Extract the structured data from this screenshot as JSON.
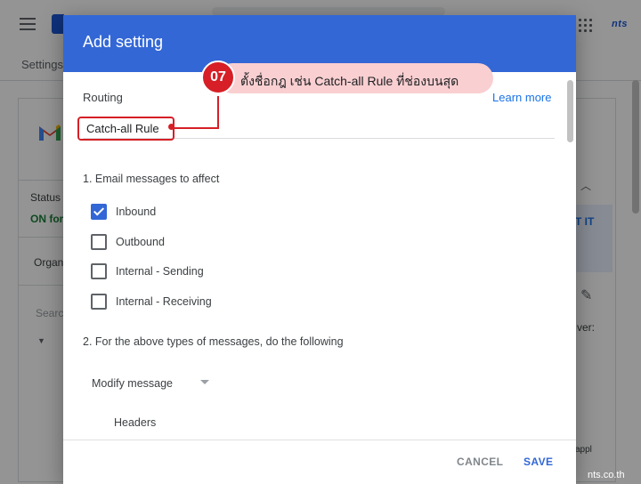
{
  "background": {
    "brand": "nts",
    "breadcrumb": "Settings",
    "status_label": "Status",
    "status_value": "ON for",
    "org_label": "Organ",
    "search_hint": "Searc",
    "right_blue_text": "T IT",
    "right_text": "ver:",
    "right_text2": "appl"
  },
  "dialog": {
    "title": "Add setting",
    "section_label": "Routing",
    "learn_more": "Learn more",
    "name_value": "Catch-all Rule",
    "step1_label": "1. Email messages to affect",
    "message_types": [
      {
        "label": "Inbound",
        "checked": true
      },
      {
        "label": "Outbound",
        "checked": false
      },
      {
        "label": "Internal - Sending",
        "checked": false
      },
      {
        "label": "Internal - Receiving",
        "checked": false
      }
    ],
    "step2_label": "2. For the above types of messages, do the following",
    "action_select": "Modify message",
    "headers_label": "Headers",
    "cancel_label": "CANCEL",
    "save_label": "SAVE"
  },
  "annotation": {
    "step_number": "07",
    "text": "ตั้งชื่อกฎ เช่น Catch-all Rule ที่ช่องบนสุด"
  },
  "watermark": "nts.co.th",
  "colors": {
    "header_blue": "#3367d6",
    "annotation_red": "#d61f26",
    "annotation_pink": "#f9cfd1",
    "link_blue": "#1a73e8"
  }
}
